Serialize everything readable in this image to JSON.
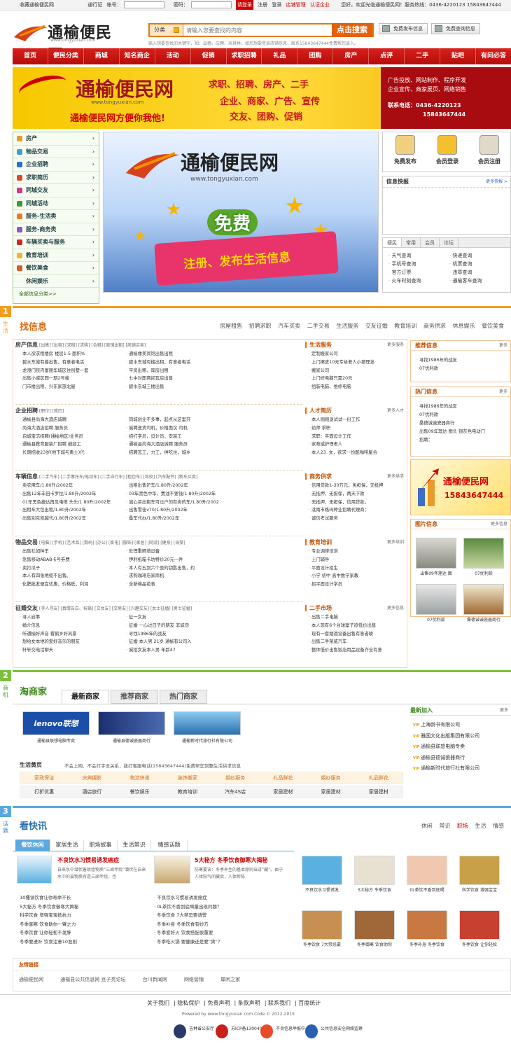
{
  "topbar": {
    "fav": "收藏通榆便民网",
    "pass": "通行证",
    "acc_label": "帐号：",
    "pwd_label": "密码：",
    "login": "请登录",
    "register": "注册",
    "login2": "登录",
    "shop_manage": "店铺管理",
    "certify": "认证企业",
    "welcome": "您好，欢迎光临通榆便民网！服务热线：0436-4220123 15843647444"
  },
  "header": {
    "logo_text": "通榆便民网",
    "logo_url": "www.tongyuxian.com",
    "search_cat": "分类",
    "search_placeholder": "请输入您要查找的内容",
    "search_btn": "点击搜索",
    "hint": "输入想要查找的关键字，如：出租、应聘、米其林，如您想要登录店铺信息，联系15843647444免费帮您录入。",
    "btn_post": "免费发布信息",
    "btn_query": "免费查询信息"
  },
  "nav": [
    "首页",
    "便民分类",
    "商城",
    "知名商企",
    "活动",
    "促销",
    "求职招聘",
    "礼品",
    "团购",
    "房产",
    "点评",
    "二手",
    "贴吧",
    "有问必答"
  ],
  "banner": {
    "logo": "通榆便民网",
    "url": "www.tongyuxian.com",
    "slogan": "通榆便民网方便你我他!",
    "m1": "求职、招聘、房产、二手",
    "m2": "企业、商家、广告、宣传",
    "m3": "交友、团购、促销",
    "r1": "广告投放、网站制作、程序开发",
    "r2": "企业宣传、商家展页、网络销售",
    "r3": "联系电话：0436-4220123",
    "r4": "15843647444"
  },
  "categories": [
    {
      "label": "房产",
      "color": "#e89a2a"
    },
    {
      "label": "物品交易",
      "color": "#3aa0d8"
    },
    {
      "label": "企业招聘",
      "color": "#2a70c8"
    },
    {
      "label": "求职简历",
      "color": "#d84a2a"
    },
    {
      "label": "同城交友",
      "color": "#c83a8a"
    },
    {
      "label": "同城活动",
      "color": "#3a9a3a"
    },
    {
      "label": "服务-生活类",
      "color": "#e87a2a"
    },
    {
      "label": "服务-商务类",
      "color": "#8a5ac8"
    },
    {
      "label": "车辆买卖与服务",
      "color": "#c82a2a"
    },
    {
      "label": "教育培训",
      "color": "#e8b82a"
    },
    {
      "label": "餐饮美食",
      "color": "#d85a2a"
    },
    {
      "label": "休闲娱乐",
      "color": "#ffffff"
    }
  ],
  "cat_all": "全部信息分类>>",
  "center_ad": {
    "logo": "通榆便民网",
    "url": "www.tongyuxian.com",
    "free": "免费",
    "box": "注册、发布生活信息"
  },
  "quick_actions": [
    {
      "label": "免费发布",
      "color": "#f0d080"
    },
    {
      "label": "会员登录",
      "color": "#f4c030"
    },
    {
      "label": "会员注册",
      "color": "#e0d8c8"
    }
  ],
  "news": {
    "title": "信息快报",
    "more": "更多快报 >"
  },
  "quick": {
    "tabs": [
      "便民",
      "常用",
      "会员",
      "论坛"
    ],
    "links": [
      "天气查询",
      "快递查询",
      "手机号查询",
      "机票查询",
      "官方订票",
      "违章查询",
      "火车时刻查询",
      "通榆客车查询"
    ]
  },
  "sec1": {
    "num": "1",
    "label": "生活",
    "title": "找信息",
    "tabs": [
      "房屋租售",
      "招聘求职",
      "汽车买卖",
      "二手交易",
      "生活服务",
      "交友征婚",
      "教育培训",
      "商务供求",
      "休息娱乐",
      "餐饮美食"
    ]
  },
  "blocks": [
    {
      "title": "房产信息",
      "tags": "[出售] [出租] [求租] [求购] [合租] [商铺出租] [商铺买卖]",
      "items": [
        "本人欲求租楼房 楼层1-5 面积%",
        "通榆缘美宾馆出售出租",
        "碧水东城有楼出售，有意者电话",
        "碧水东城有楼出租，有意者电话",
        "龙港门院内富丽华城区住别墅一套",
        "平房出租、库房出租",
        "出售小城区园一期2号楼",
        "七中对面两间瓦房出售",
        "门市楼出租，兴东家旅北屋",
        "碧水东城三楼出售"
      ]
    },
    {
      "title": "企业招聘",
      "tags": "[职位] [简历]",
      "items": [
        "通榆县尚海大酒店诚聘",
        "同城创业不多事，起点从这里开",
        "尚海大酒店招聘 服务员",
        "诚聘送货司机，价格面议 司机",
        "白城宝洁招聘(通榆地区)业务员",
        "招打字员，设计员，安装工",
        "通榆县教育服装厂招聘 缝纫工",
        "通榆县尚海大酒店诚聘 服务员",
        "长期招收23岁(地下城与勇士)代",
        "招聘瓦工，力工，供吃住，城乡"
      ]
    },
    {
      "title": "车辆信息",
      "tags": "[二手汽车] [二手摩托车/电动车] [二手自行车] [租包车] [驾校] [汽车配件] [新车买卖]",
      "items": [
        "卖农用车/1.80升/2002年",
        "出租出售铲车/1.80升/2002年",
        "出售12年丰田卡罗拉/1.80升/2002年",
        "03年黑色中华，费油不要钱/1.80升/2002年",
        "01年黑色捷达再见电喷 头头/1.80升/2002年",
        "诚心买出租车可过户的有类的车/1.80升/2002",
        "出租车大包出租/1.80升/2002年",
        "出售雪佳v70/1.80升/2002年",
        "出售别克凯越代/1.80升/2002年",
        "桑车代办/1.80升/2002年"
      ]
    },
    {
      "title": "物品交易",
      "tags": "[电脑] [手机] [艺术品] [数码] [办公] [家电] [服饰] [家居] [网游] [健身] [母婴]",
      "items": [
        "出售社如种羊",
        "处理重晒填设备",
        "急售移动ABAB卡号券费",
        "伊利纸箱卡坊特价20元一件",
        "卖打瓜子",
        "本人有五到六个至的钥匙出售，约",
        "本人有四张地缆不出售。",
        "求购珈琲店家商机",
        "化肥批发便宜优惠，价格低，利润",
        "全新棉晶花表"
      ]
    },
    {
      "title": "征婚交友",
      "tags": "[寻人寻友] [真情告白、祝福] [交女友] [交男友] [兴趣交友] [女士征婚] [男士征婚]",
      "items": [
        "寻人启事",
        "征一女友",
        "婚介信息",
        "征婚 一心过日子的朋友 非诚勿",
        "听通榆好声音 看鹤乡好风景",
        "寻找1986年的战友",
        "想给女本地的爱好音乐的朋友",
        "征婚 本人男 21岁 通榆有公司入",
        "轩轩交电话聊天",
        "诚招女友本人男 年龄47"
      ]
    }
  ],
  "mid_cols": [
    {
      "title": "生活服务",
      "more": "更多服务",
      "items": [
        "定制搬家公司",
        "上门擦皮10元专给老人小孩理发",
        "搬家公司",
        "上门修电脑只需20元",
        "组装电脑、维修电脑"
      ]
    },
    {
      "title": "人才简历",
      "more": "更多人才",
      "items": [
        "本人刚刚退试试一份工作",
        "幼师 求职",
        "求职：平面设计工作",
        "家政或护理老人",
        "本人23 .女，欲求一份酷咖啡屋合"
      ]
    },
    {
      "title": "商务供求",
      "more": "更多供求",
      "items": [
        "信用贷款1-30万元，免担保，无抵押",
        "无抵押、无担保，两天下款",
        "无抵押，无担保，信用贷款。",
        "洮南市格玛种业招聘代理商：",
        "诚信考试服务"
      ]
    },
    {
      "title": "教育培训",
      "more": "更多培训",
      "items": [
        "专业调律培训",
        "上门辅导",
        "平面设计招生",
        "小学 初中 高中数学家教",
        "招平面设计学员"
      ]
    },
    {
      "title": "二手市场",
      "more": "更多信息",
      "items": [
        "出售二手电脑",
        "本人现有6个台球案子欲低价出售",
        "现有一套烟酒设备出售有意者联",
        "出售二手荣威汽车",
        "整体低价出售饭店用品设备齐全有意"
      ]
    }
  ],
  "right_boxes": {
    "recommend": {
      "title": "推荐信息",
      "more": "更多",
      "items": [
        "寻找1986年的战友",
        "07优利款"
      ]
    },
    "hot": {
      "title": "热门信息",
      "more": "更多",
      "items": [
        "寻找1986年的战友",
        "07优利款",
        "桑德诚诚瓷器商行",
        "出售09年理达 图头 银灰色电动门",
        "招聘："
      ]
    },
    "ad_title": "通榆便民网",
    "ad_phone": "15843647444",
    "pics": {
      "title": "图片信息",
      "more": "更多信息",
      "items": [
        "出售09年理达 图",
        "07优利款",
        "07优利款",
        "桑德诚诚瓷器商行"
      ]
    }
  },
  "sec2": {
    "num": "2",
    "label": "商机",
    "title": "淘商家",
    "tabs": [
      "最新商家",
      "推荐商家",
      "热门商家"
    ],
    "logos": [
      {
        "name": "通榆县联想电脑专卖",
        "brand": "lenovo联想"
      },
      {
        "name": "通榆县德诚瓷器商行",
        "brand": ""
      },
      {
        "name": "通榆新时代旅行社有限公司",
        "brand": ""
      }
    ],
    "latest": {
      "title": "最新加入",
      "more": "更多",
      "items": [
        "上海龄书有限公司",
        "雅国文化出版集团有限公司",
        "通榆县联想电脑专卖",
        "通榆县德诚瓷器商行",
        "通榆新时代旅行社有限公司"
      ]
    },
    "life_title": "生活黄页",
    "life_desc": "不会上网、不会打字没关系，拨打客服电话(15843647444)免费帮您到整生活供求信息",
    "life_row1": [
      "家政保洁",
      "庆典摄影",
      "物流快递",
      "装饰搬家",
      "婚纱服务",
      "礼品鲜花",
      "婚纱服务",
      "礼品鲜花"
    ],
    "life_row2": [
      "打折优惠",
      "酒店旅行",
      "餐饮娱乐",
      "教育培训",
      "汽车4S店",
      "家居建材",
      "家居建材",
      "家居建材"
    ]
  },
  "sec3": {
    "num": "3",
    "label": "话题",
    "title": "看快讯",
    "tabs_right": [
      "休闲",
      "常识",
      "职场",
      "生活",
      "情感"
    ],
    "tabs": [
      "餐饮休闲",
      "家居生活",
      "职场故事",
      "生活常识",
      "情感话题"
    ],
    "feat1": {
      "title": "不良饮水习惯易诱发癌症",
      "desc": "自来水中潜伏着致癌物质“三卤甲烷”潜伏在自来水中的氯物质有是三卤甲烷，也"
    },
    "feat2": {
      "title": "5大秘方 冬季饮食御寒大揭秘",
      "desc": "防寒要诀：冬季养生的基本原则当讲“藏”。由于人体阳气闭藏后，人体新陈"
    },
    "list1": [
      "10種误饮食让你寿命不长",
      "5大秘方 冬季饮食御寒大揭秘",
      "科学饮食 增强宝宝抵抗力",
      "冬季御寒 饮食助你一臂之力",
      "冬季饮食 让你轻松不发胖",
      "冬季要进补 饮食注意10准则"
    ],
    "list2": [
      "不良饮水习惯易诱发癌症",
      "0L茶饮不香到底喝量出现问题？",
      "冬季饮食 7大禁忌要请警",
      "冬季补身 冬季饮食有妙方",
      "冬季爱好火 饮食搭配很重要",
      "冬季吃火锅 要健康还是要“爽”？"
    ],
    "thumbs": [
      "不良饮水习惯诱发",
      "5大秘方 冬季饮食",
      "0L茶饮不香到底喝",
      "科学饮食 增强宝宝",
      "冬季饮食 7大禁忌要",
      "冬季御寒 饮食助你",
      "冬季补身 冬季饮食",
      "冬季饮食 让你轻松"
    ],
    "thumb_colors": [
      "#5ab0e0",
      "#e8e0d0",
      "#f0c8b0",
      "#c8a048",
      "#c89050",
      "#a06838",
      "#c87840",
      "#c84030"
    ],
    "friend_title": "友情链接",
    "friends": [
      "通榆便民网",
      "通榆县公共信息网 豆子亮论坛",
      "台川新闻网",
      "网络营销",
      "犀闲之家"
    ]
  },
  "footer": {
    "links": [
      "关于我们",
      "隐私保护",
      "免责声明",
      "条款声明",
      "联系我们",
      "百度统计"
    ],
    "copy": "Powered by www.tongyuxian.com Code © 2012-2015",
    "badges": [
      "吉林省公安厅",
      "苏ICP备13004956号",
      "不良信息举报中心",
      "公共信息安全网络监察"
    ]
  }
}
